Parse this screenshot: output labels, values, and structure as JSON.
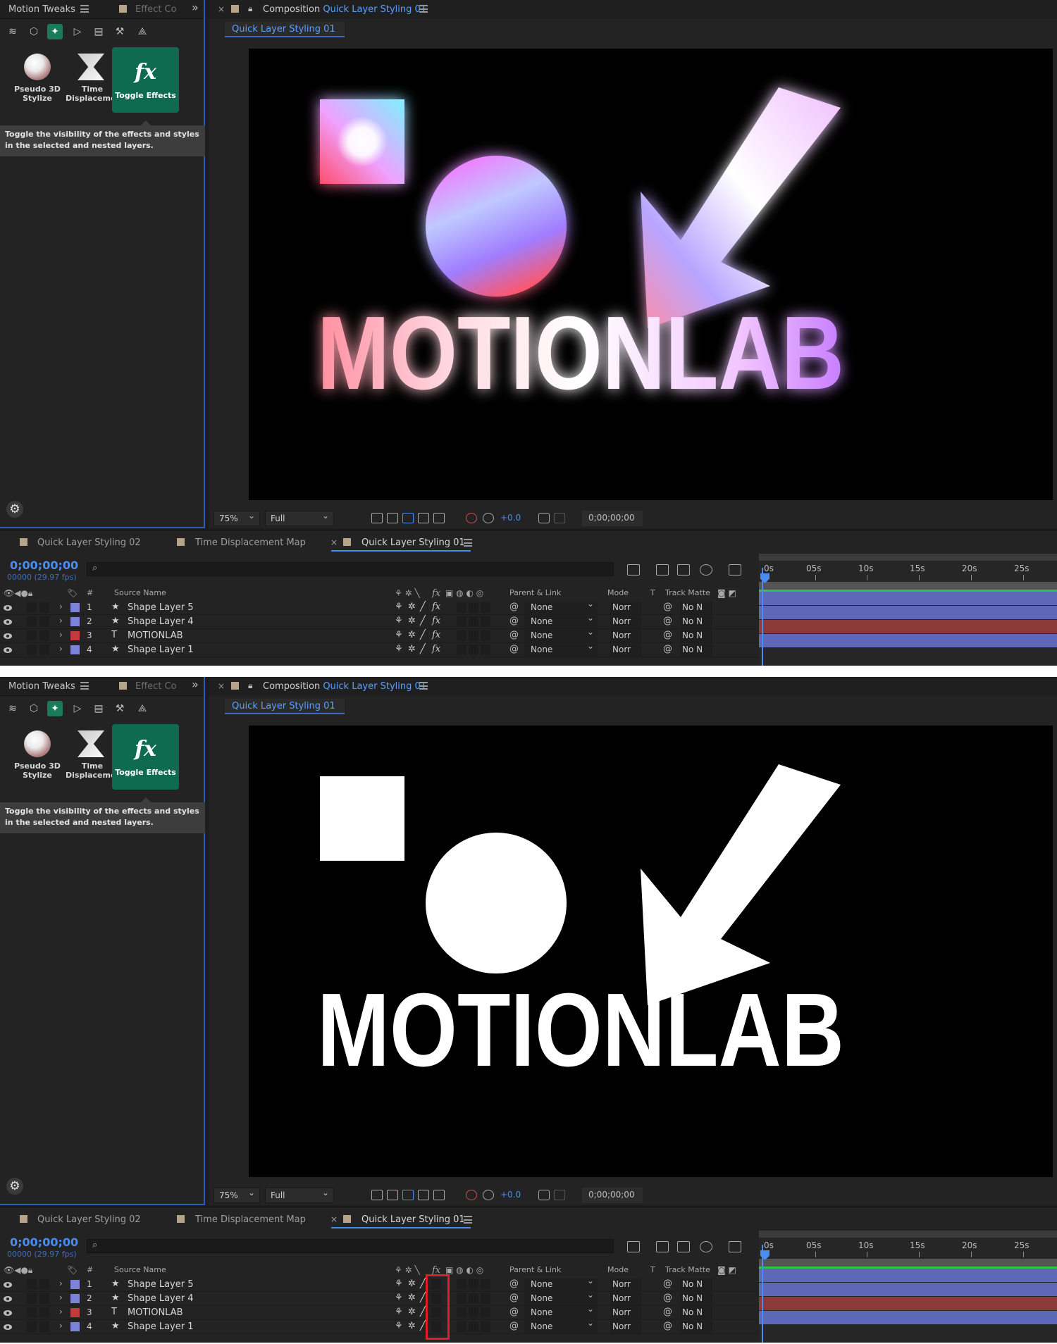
{
  "left_panel": {
    "tab_active": "Motion Tweaks",
    "tab_inactive": "Effect Co",
    "tiles": [
      {
        "label": "Pseudo 3D\nStylize",
        "icon": "sphere-icon"
      },
      {
        "label": "Time\nDisplacemen",
        "icon": "hourglass-icon"
      },
      {
        "label": "Toggle Effects",
        "glyph": "fx",
        "icon": "fx-icon"
      }
    ],
    "tooltip": "Toggle the visibility of the effects and styles in the selected and nested layers."
  },
  "comp_panel": {
    "title_prefix": "Composition",
    "title_name": "Quick Layer Styling 01",
    "breadcrumb": "Quick Layer Styling 01",
    "zoom": "75%",
    "resolution": "Full",
    "exposure": "+0.0",
    "timecode": "0;00;00;00"
  },
  "artwork": {
    "text": "MOTIONLAB"
  },
  "timeline": {
    "tabs": [
      "Quick Layer Styling 02",
      "Time Displacement Map",
      "Quick Layer Styling 01"
    ],
    "timecode": "0;00;00;00",
    "fps": "00000 (29.97 fps)",
    "headers": {
      "num": "#",
      "source_name": "Source Name",
      "parent": "Parent & Link",
      "mode": "Mode",
      "t": "T",
      "track_matte": "Track Matte"
    },
    "fx_glyph": "fx",
    "ruler": [
      "0s",
      "05s",
      "10s",
      "15s",
      "20s",
      "25s"
    ],
    "layers": [
      {
        "num": "1",
        "type": "★",
        "name": "Shape Layer 5",
        "color": "#7b84d8",
        "parent": "None",
        "mode": "Norr",
        "matte": "No N"
      },
      {
        "num": "2",
        "type": "★",
        "name": "Shape Layer 4",
        "color": "#7b84d8",
        "parent": "None",
        "mode": "Norr",
        "matte": "No N"
      },
      {
        "num": "3",
        "type": "T",
        "name": "MOTIONLAB",
        "color": "#c23a3a",
        "parent": "None",
        "mode": "Norr",
        "matte": "No N"
      },
      {
        "num": "4",
        "type": "★",
        "name": "Shape Layer 1",
        "color": "#7b84d8",
        "parent": "None",
        "mode": "Norr",
        "matte": "No N"
      }
    ]
  },
  "colors": {
    "accent_blue": "#4a8df2",
    "active_green": "#0e6b4f",
    "highlight_red": "#e01e2a"
  }
}
